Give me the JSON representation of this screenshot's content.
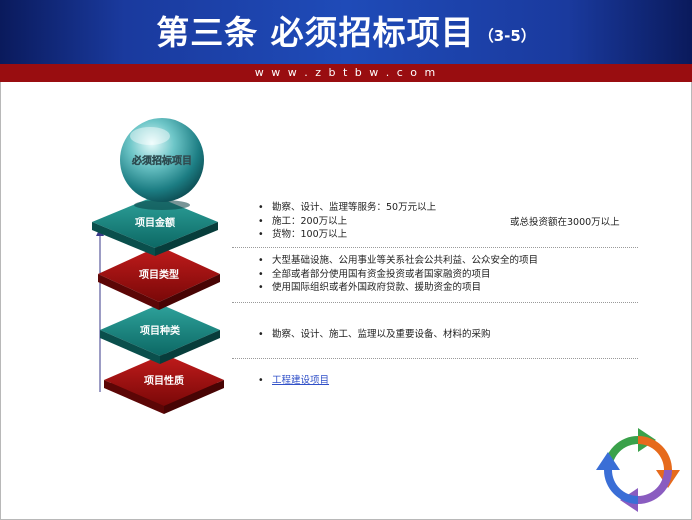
{
  "header": {
    "title": "第三条  必须招标项目",
    "title_sub": "（3-5）",
    "url": "w w w . z b t b w . c o m"
  },
  "colors": {
    "header_blue": "#1f4bb8",
    "url_bar_red": "#990d10",
    "teal_block": "#0e6e6a",
    "red_block": "#8a0c0c",
    "link_blue": "#3050c8"
  },
  "sphere": {
    "label": "必须招标项目"
  },
  "blocks": [
    {
      "label": "项目金额"
    },
    {
      "label": "项目类型"
    },
    {
      "label": "项目种类"
    },
    {
      "label": "项目性质"
    }
  ],
  "rows": {
    "amount": {
      "items": [
        "勘察、设计、监理等服务：50万元以上",
        "施工：200万以上",
        "货物：100万以上"
      ],
      "aside": "或总投资额在3000万以上"
    },
    "type": {
      "items": [
        "大型基础设施、公用事业等关系社会公共利益、公众安全的项目",
        "全部或者部分使用国有资金投资或者国家融资的项目",
        "使用国际组织或者外国政府贷款、援助资金的项目"
      ]
    },
    "kind": {
      "items": [
        "勘察、设计、施工、监理以及重要设备、材料的采购"
      ]
    },
    "nature": {
      "link": "工程建设项目"
    }
  },
  "icons": {
    "logo": "recycle-arrows-icon"
  }
}
